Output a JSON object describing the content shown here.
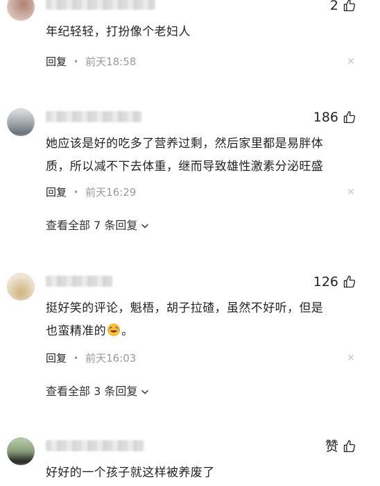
{
  "comments": [
    {
      "text_lines": [
        "年纪轻轻，打扮像个老妇人"
      ],
      "likes": "2",
      "reply_label": "回复",
      "time": "前天18:58"
    },
    {
      "text_lines": [
        "她应该是好的吃多了营养过剩，然后家里都是易胖体",
        "质，所以减不下去体重，继而导致雄性激素分泌旺盛"
      ],
      "likes": "186",
      "reply_label": "回复",
      "time": "前天16:29",
      "view_replies": "查看全部 7 条回复"
    },
    {
      "text_lines": [
        "挺好笑的评论，魁梧，胡子拉碴，虽然不好听，但是",
        "也蛮精准的"
      ],
      "trailing_punct": "。",
      "likes": "126",
      "reply_label": "回复",
      "time": "前天16:03",
      "view_replies": "查看全部 3 条回复"
    },
    {
      "text_lines": [
        "好好的一个孩子就这样被养废了"
      ],
      "likes": "赞"
    }
  ],
  "icons": {
    "like": "thumbs-up-icon",
    "close": "close-icon",
    "chevron": "chevron-down-icon",
    "emoji": "laughing-emoji-icon"
  }
}
